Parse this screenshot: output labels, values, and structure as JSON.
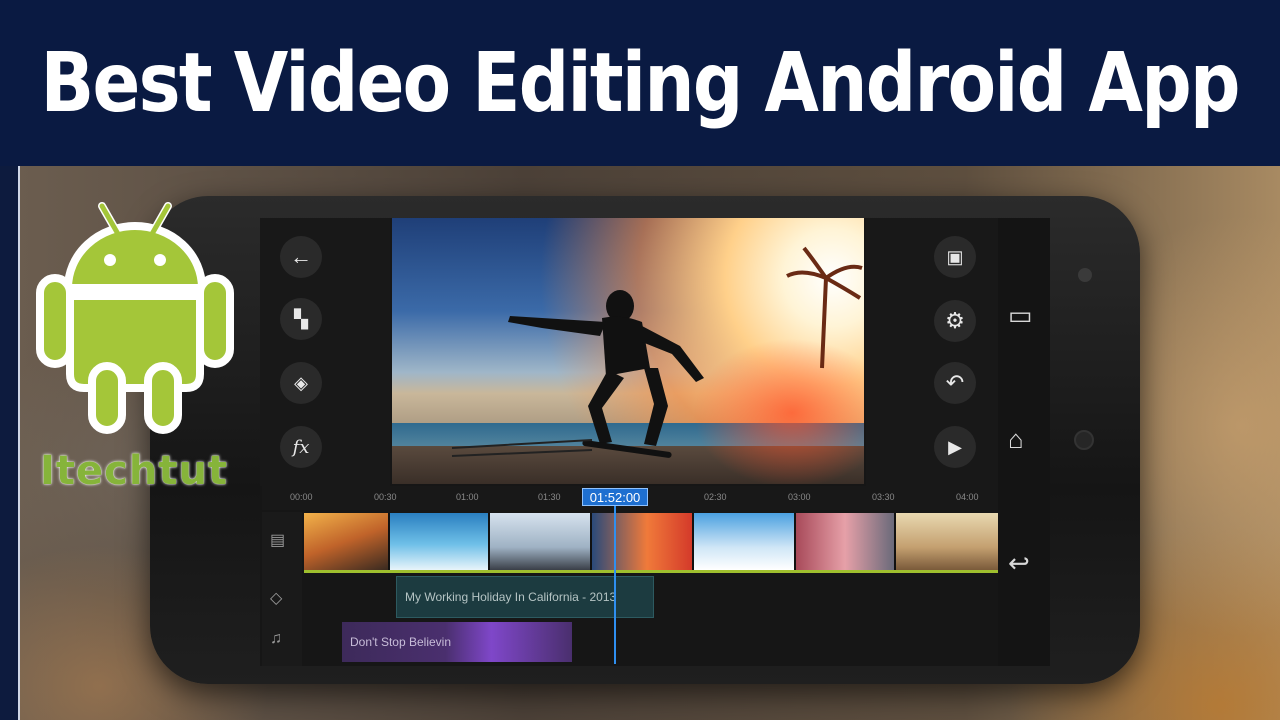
{
  "banner": {
    "title": "Best Video Editing Android App"
  },
  "brand": {
    "name": "Itechtut",
    "color": "#86b43a"
  },
  "editor": {
    "left_tools": [
      {
        "icon": "back-arrow-icon",
        "glyph": "←"
      },
      {
        "icon": "add-media-icon",
        "glyph": "▚"
      },
      {
        "icon": "layers-icon",
        "glyph": "◈"
      },
      {
        "icon": "fx-icon",
        "glyph": "fx"
      }
    ],
    "right_tools": [
      {
        "icon": "export-icon",
        "glyph": "▣"
      },
      {
        "icon": "settings-icon",
        "glyph": "⚙"
      },
      {
        "icon": "undo-icon",
        "glyph": "↶"
      },
      {
        "icon": "play-icon",
        "glyph": "▶"
      }
    ],
    "nav": [
      {
        "icon": "recent-apps-icon",
        "glyph": "▭"
      },
      {
        "icon": "home-icon",
        "glyph": "⌂"
      },
      {
        "icon": "nav-back-icon",
        "glyph": "↩"
      }
    ],
    "timeline": {
      "ruler": [
        "00:00",
        "00:30",
        "01:00",
        "01:30",
        "02:30",
        "03:00",
        "03:30",
        "04:00"
      ],
      "current_time": "01:52:00",
      "caption_text": "My Working Holiday In California - 2013",
      "audio_text": "Don't Stop Believin",
      "track_icons": [
        {
          "icon": "video-track-icon",
          "glyph": "▤"
        },
        {
          "icon": "layer-track-icon",
          "glyph": "◇"
        },
        {
          "icon": "music-track-icon",
          "glyph": "♫"
        }
      ]
    }
  },
  "colors": {
    "banner_bg": "#0a1a42",
    "timeline_accent": "#1e6fd0",
    "clip_border": "#9fbf2e",
    "audio_track": "#7f47c9",
    "android_green": "#a4c639"
  }
}
